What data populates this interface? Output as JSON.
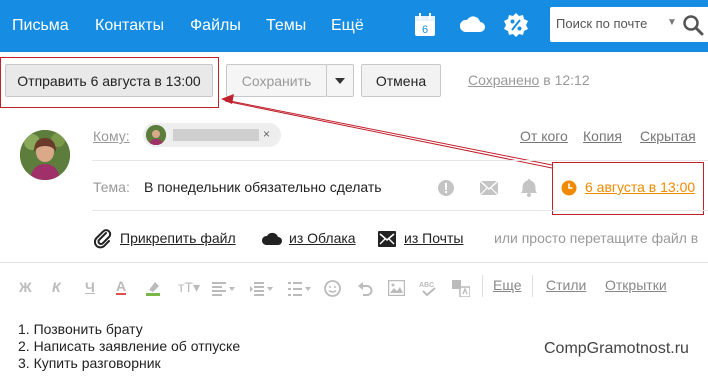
{
  "nav": {
    "items": [
      "Письма",
      "Контакты",
      "Файлы",
      "Темы",
      "Ещё"
    ],
    "calendar_day": "6",
    "search_placeholder": "Поиск по почте"
  },
  "toolbar": {
    "send_label": "Отправить 6 августа в 13:00",
    "save_label": "Сохранить",
    "cancel_label": "Отмена",
    "saved_word": "Сохранено",
    "saved_time": " в 12:12"
  },
  "compose": {
    "to_label": "Кому:",
    "from_link": "От кого",
    "cc_link": "Копия",
    "bcc_link": "Скрытая",
    "subject_label": "Тема:",
    "subject_value": "В понедельник обязательно сделать",
    "scheduled_date": "6 августа в 13:00",
    "recipient_remove": "×"
  },
  "attach": {
    "file": "Прикрепить файл",
    "cloud": "из Облака",
    "mail": "из Почты",
    "hint": "или просто перетащите файл в"
  },
  "format": {
    "more": "Еще",
    "styles": "Стили",
    "cards": "Открытки"
  },
  "body_lines": [
    "1. Позвонить брату",
    "2. Написать заявление об отпуске",
    "3. Купить разговорник"
  ],
  "watermark": "CompGramotnost.ru",
  "colors": {
    "nav_bg": "#168de2",
    "accent_orange": "#f08a00",
    "highlight_red": "#c0212c"
  }
}
